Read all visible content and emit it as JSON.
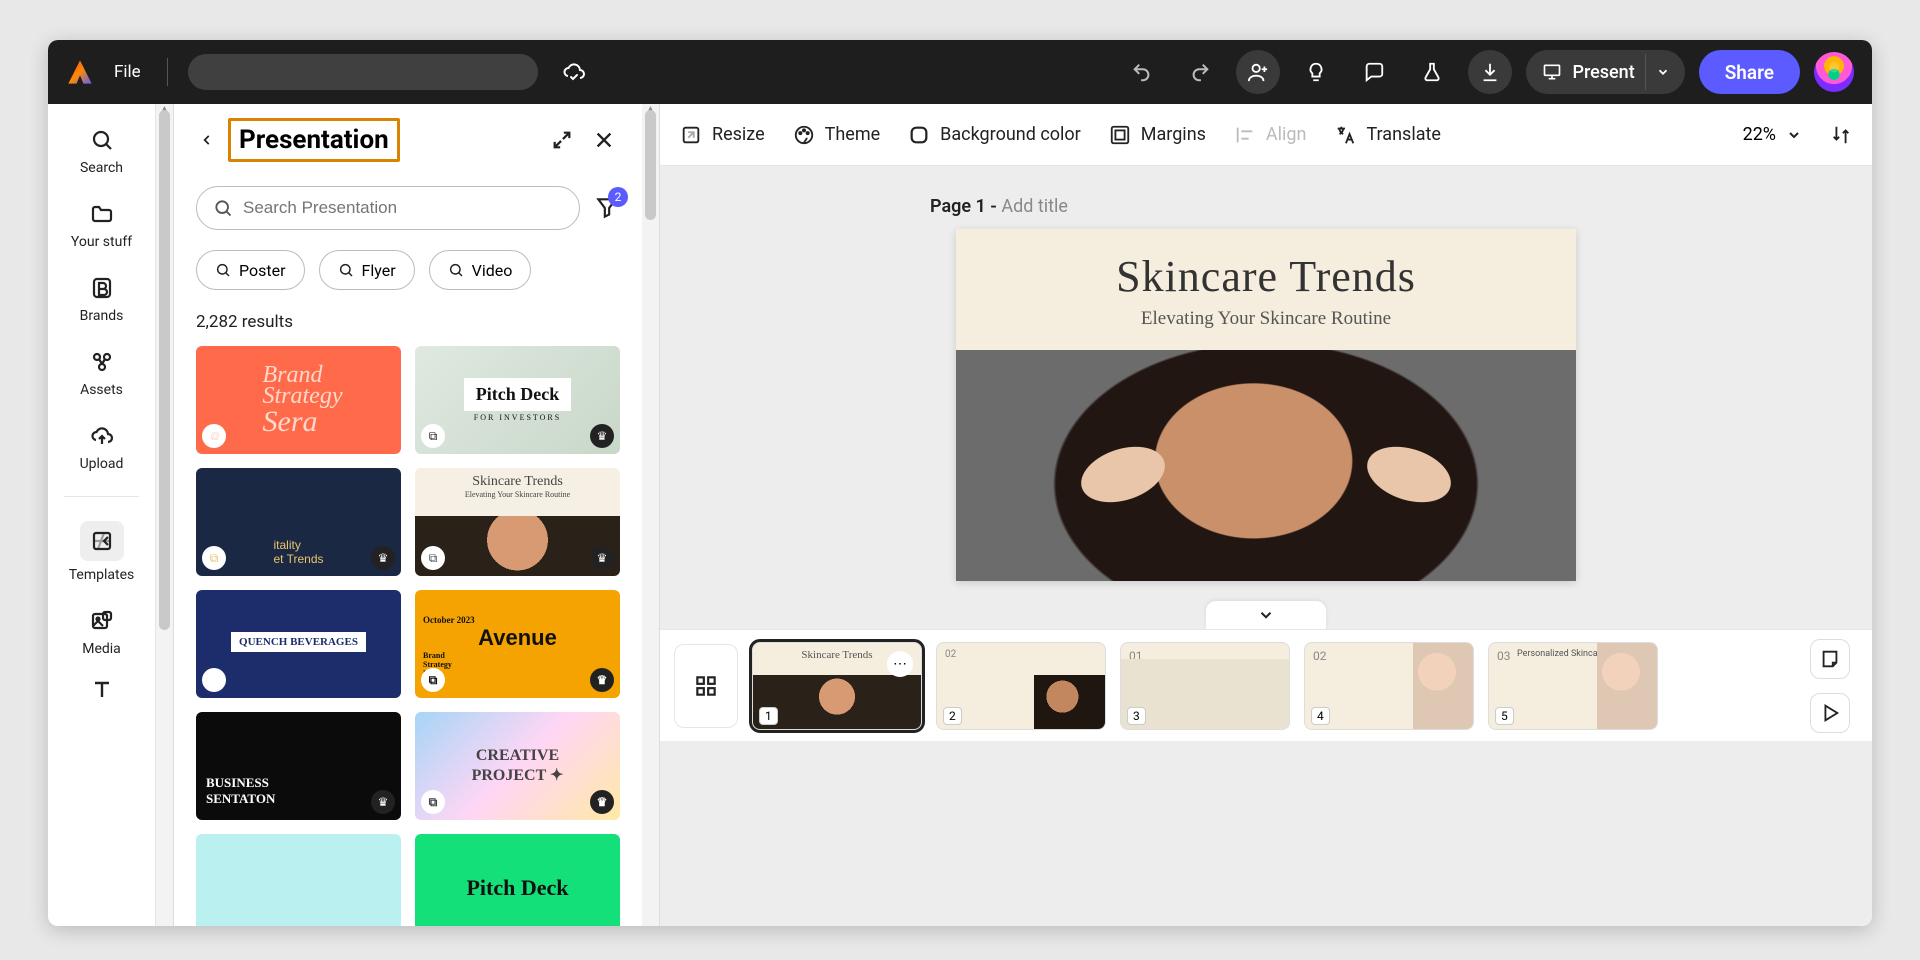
{
  "topbar": {
    "file": "File",
    "present": "Present",
    "share": "Share"
  },
  "leftnav": {
    "search": "Search",
    "your_stuff": "Your stuff",
    "brands": "Brands",
    "assets": "Assets",
    "upload": "Upload",
    "templates": "Templates",
    "media": "Media"
  },
  "panel": {
    "title": "Presentation",
    "search_placeholder": "Search Presentation",
    "filter_count": "2",
    "chips": {
      "poster": "Poster",
      "flyer": "Flyer",
      "video": "Video"
    },
    "results": "2,282 results",
    "templates": {
      "t1a": "Brand",
      "t1b": "Strategy",
      "t1c": "Sera",
      "t2a": "Pitch Deck",
      "t2b": "FOR INVESTORS",
      "t3": "itality\net Trends",
      "t4a": "Skincare Trends",
      "t4b": "Elevating Your Skincare Routine",
      "t5a": "QUENCH BEVERAGES",
      "t6a": "October 2023",
      "t6b": "Avenue",
      "t6c": "Brand\nStrategy\nDeck",
      "t7a": "BUSINESS",
      "t7b": "SENTATON",
      "t8a": "CREATIVE",
      "t8b": "PROJECT ✦",
      "t10": "Pitch Deck"
    }
  },
  "canvas_toolbar": {
    "resize": "Resize",
    "theme": "Theme",
    "bg": "Background color",
    "margins": "Margins",
    "align": "Align",
    "translate": "Translate",
    "zoom": "22%"
  },
  "page": {
    "label_prefix": "Page 1 - ",
    "label_placeholder": "Add title",
    "title": "Skincare Trends",
    "subtitle": "Elevating Your Skincare Routine"
  },
  "filmstrip": {
    "n1": "1",
    "n2": "2",
    "n3": "3",
    "n4": "4",
    "n5": "5",
    "t1": "Skincare Trends",
    "t2_a": "02",
    "t3_a": "01",
    "t4_a": "02",
    "t5_a": "03",
    "t5_b": "Personalized Skincare"
  }
}
